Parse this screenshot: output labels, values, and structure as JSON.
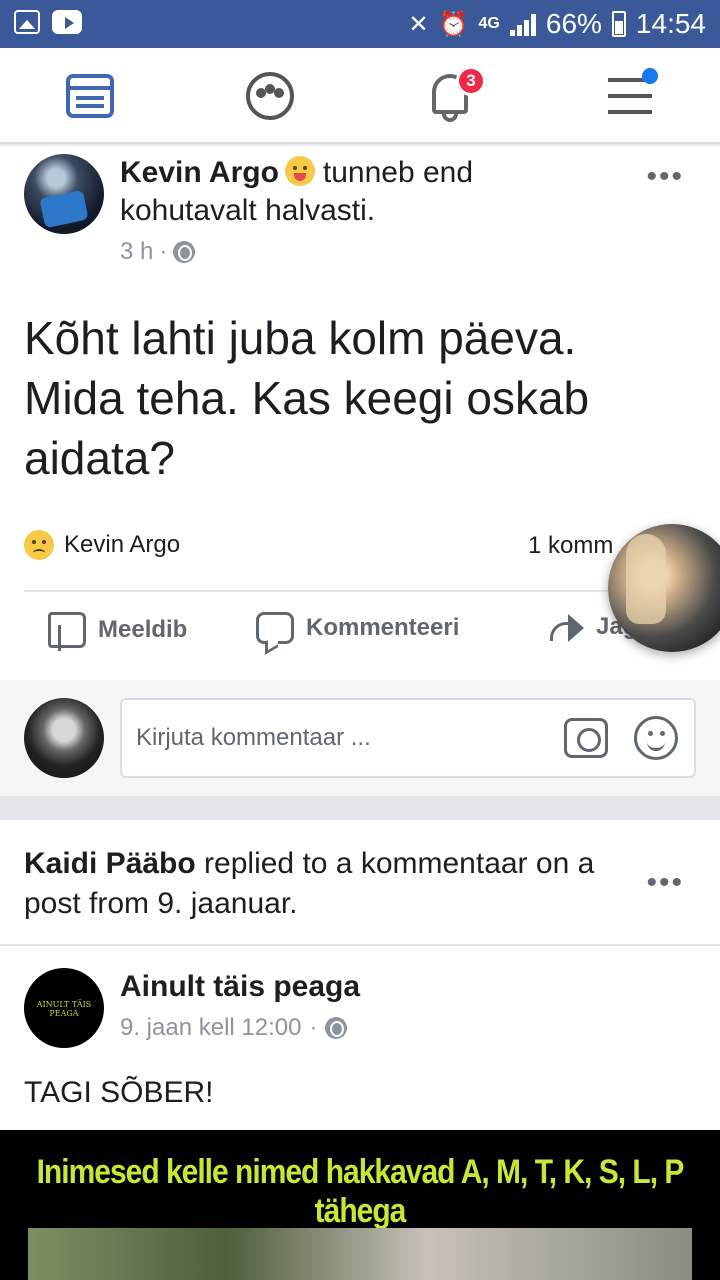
{
  "status_bar": {
    "network": "4G",
    "battery": "66%",
    "time": "14:54"
  },
  "nav": {
    "notification_count": "3"
  },
  "post1": {
    "author": "Kevin Argo",
    "feeling": "tunneb end kohutavalt halvasti.",
    "time": "3 h",
    "text": "Kõht lahti juba kolm päeva. Mida teha. Kas keegi oskab aidata?",
    "reaction_name": "Kevin Argo",
    "comment_count": "1 komm",
    "actions": {
      "like": "Meeldib",
      "comment": "Kommenteeri",
      "share": "Jag"
    }
  },
  "composer": {
    "placeholder": "Kirjuta kommentaar ..."
  },
  "post2": {
    "reply_name": "Kaidi Pääbo",
    "reply_text": " replied to a kommentaar on a post from 9. jaanuar.",
    "page_name": "Ainult täis peaga",
    "avatar_text": "AINULT TÄIS PEAGA",
    "time": "9. jaan kell 12:00",
    "text": "TAGI SÕBER!",
    "image_title": "Inimesed kelle nimed hakkavad A, M, T, K, S, L, P tähega"
  },
  "colors": {
    "brand": "#3b5998",
    "accent": "#4267b2",
    "badge": "#f02849"
  }
}
